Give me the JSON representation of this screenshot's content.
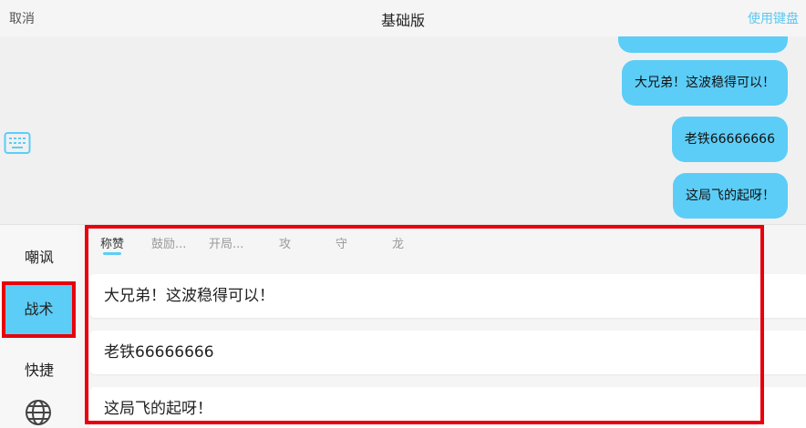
{
  "header": {
    "cancel_label": "取消",
    "title": "基础版",
    "use_keyboard_label": "使用键盘"
  },
  "chat": {
    "messages": [
      "大兄弟！这波稳得可以！",
      "老铁66666666",
      "这局飞的起呀！"
    ]
  },
  "sidebar": {
    "items": [
      {
        "label": "嘲讽"
      },
      {
        "label": "战术"
      },
      {
        "label": "快捷"
      }
    ],
    "active": "战术"
  },
  "tabs": [
    {
      "label": "称赞"
    },
    {
      "label": "鼓励..."
    },
    {
      "label": "开局..."
    },
    {
      "label": "攻"
    },
    {
      "label": "守"
    },
    {
      "label": "龙"
    }
  ],
  "active_tab": "称赞",
  "phrases": [
    "大兄弟！这波稳得可以！",
    "老铁66666666",
    "这局飞的起呀！"
  ],
  "colors": {
    "accent": "#5ccdf7",
    "highlight": "#e8000b"
  },
  "icons": {
    "keyboard": "keyboard-icon",
    "language": "globe-icon"
  }
}
